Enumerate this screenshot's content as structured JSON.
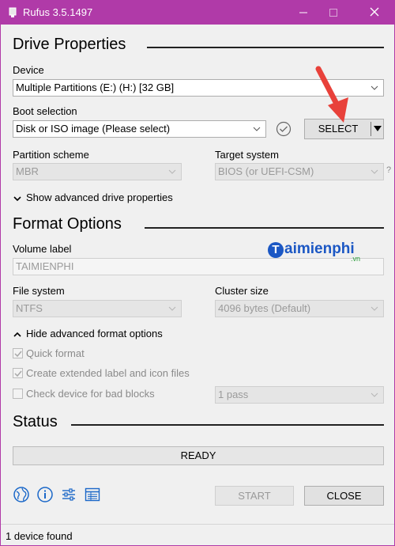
{
  "window": {
    "title": "Rufus 3.5.1497",
    "accent": "#b03aa8"
  },
  "drive_properties": {
    "heading": "Drive Properties",
    "device_label": "Device",
    "device_value": "Multiple Partitions (E:) (H:) [32 GB]",
    "boot_label": "Boot selection",
    "boot_value": "Disk or ISO image (Please select)",
    "select_button": "SELECT",
    "partition_label": "Partition scheme",
    "partition_value": "MBR",
    "target_label": "Target system",
    "target_value": "BIOS (or UEFI-CSM)",
    "target_help": "?",
    "advanced_toggle": "Show advanced drive properties"
  },
  "format_options": {
    "heading": "Format Options",
    "volume_label": "Volume label",
    "volume_value": "TAIMIENPHI",
    "fs_label": "File system",
    "fs_value": "NTFS",
    "cluster_label": "Cluster size",
    "cluster_value": "4096 bytes (Default)",
    "advanced_toggle": "Hide advanced format options",
    "quick_format": "Quick format",
    "quick_format_checked": true,
    "extended_label": "Create extended label and icon files",
    "extended_label_checked": true,
    "bad_blocks": "Check device for bad blocks",
    "bad_blocks_checked": false,
    "passes_value": "1 pass"
  },
  "status": {
    "heading": "Status",
    "text": "READY"
  },
  "toolbar": {
    "icons": [
      "globe-icon",
      "info-icon",
      "settings-sliders-icon",
      "log-icon"
    ],
    "start_button": "START",
    "close_button": "CLOSE"
  },
  "footer": {
    "text": "1 device found"
  },
  "watermark": {
    "text": "aimienphi",
    "initial": "T",
    "suffix": ".vn"
  }
}
